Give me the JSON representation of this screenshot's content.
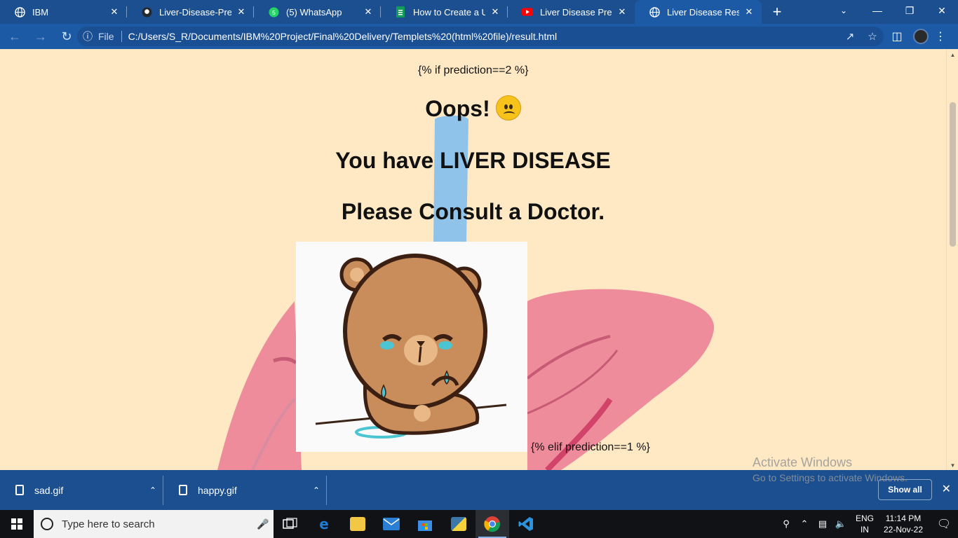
{
  "browser": {
    "tabs": [
      {
        "title": "IBM",
        "icon": "globe-icon",
        "active": false
      },
      {
        "title": "Liver-Disease-Predictio",
        "icon": "github-icon",
        "active": false
      },
      {
        "title": "(5) WhatsApp",
        "icon": "whatsapp-icon",
        "active": false
      },
      {
        "title": "How to Create a User",
        "icon": "docs-icon",
        "active": false
      },
      {
        "title": "Liver Disease Predictio",
        "icon": "youtube-icon",
        "active": false
      },
      {
        "title": "Liver Disease Result",
        "icon": "globe-icon",
        "active": true
      }
    ],
    "new_tab": "+",
    "address_bar": {
      "scheme_label": "File",
      "url": "C:/Users/S_R/Documents/IBM%20Project/Final%20Delivery/Templets%20(html%20file)/result.html"
    }
  },
  "page": {
    "template_if": "{% if prediction==2 %}",
    "heading_oops": "Oops!",
    "heading_liver": "You have LIVER DISEASE",
    "heading_doctor": "Please Consult a Doctor.",
    "template_elif": "{% elif prediction==1 %}",
    "image_alt": "crying bear"
  },
  "downloads": {
    "items": [
      {
        "name": "sad.gif"
      },
      {
        "name": "happy.gif"
      }
    ],
    "show_all": "Show all"
  },
  "watermark": {
    "line1": "Activate Windows",
    "line2": "Go to Settings to activate Windows."
  },
  "taskbar": {
    "search_placeholder": "Type here to search",
    "lang_line1": "ENG",
    "lang_line2": "IN",
    "time": "11:14 PM",
    "date": "22-Nov-22"
  },
  "colors": {
    "page_bg": "#ffe9c4",
    "chrome_blue": "#1d5aa6",
    "liver_pink": "#ee8c9c"
  }
}
